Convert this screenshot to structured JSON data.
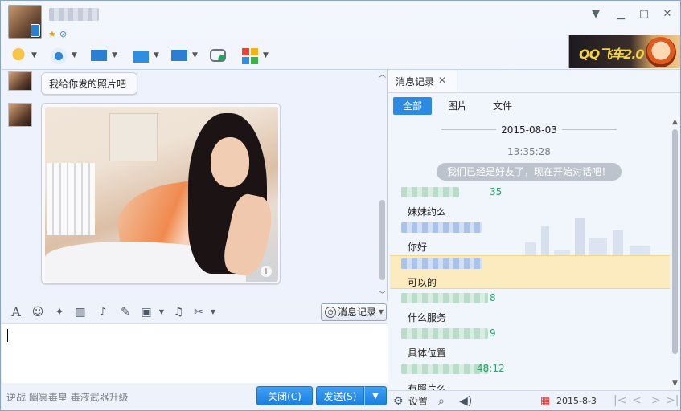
{
  "window": {
    "contact_name_blurred": "",
    "controls": {
      "min": "▁",
      "restore": "▢",
      "close": "✕",
      "menu": "▼"
    }
  },
  "toolbar": {
    "items": [
      "microphone-icon",
      "webcam-icon",
      "screen-share-icon",
      "send-file-icon",
      "remote-assist-icon",
      "add-message-icon",
      "apps-icon"
    ]
  },
  "ad_banner": {
    "text": "QQ飞车2.0"
  },
  "chat": {
    "messages": [
      {
        "type": "text",
        "text": "我给你发的照片吧"
      },
      {
        "type": "image",
        "zoom_label": "+"
      }
    ]
  },
  "input_tools": {
    "history_label": "消息记录"
  },
  "footer": {
    "ad_text": "逆战 幽冥毒皇 毒液武器升级",
    "close_label": "关闭(C)",
    "send_label": "发送(S)"
  },
  "history": {
    "tab_label": "消息记录",
    "filters": [
      "全部",
      "图片",
      "文件"
    ],
    "date": "2015-08-03",
    "sys_time": "13:35:28",
    "sys_message": "我们已经是好友了，现在开始对话吧！",
    "entries": [
      {
        "time": "35",
        "text": "妹妹约么"
      },
      {
        "time": "",
        "text": "你好"
      },
      {
        "time": "",
        "text": "可以的",
        "highlighted": true
      },
      {
        "time": "8",
        "text": "什么服务"
      },
      {
        "time": "9",
        "text": "具体位置"
      },
      {
        "time": "48:12",
        "text": "有照片么"
      }
    ],
    "footer": {
      "settings_label": "设置",
      "date_label": "2015-8-3"
    }
  }
}
